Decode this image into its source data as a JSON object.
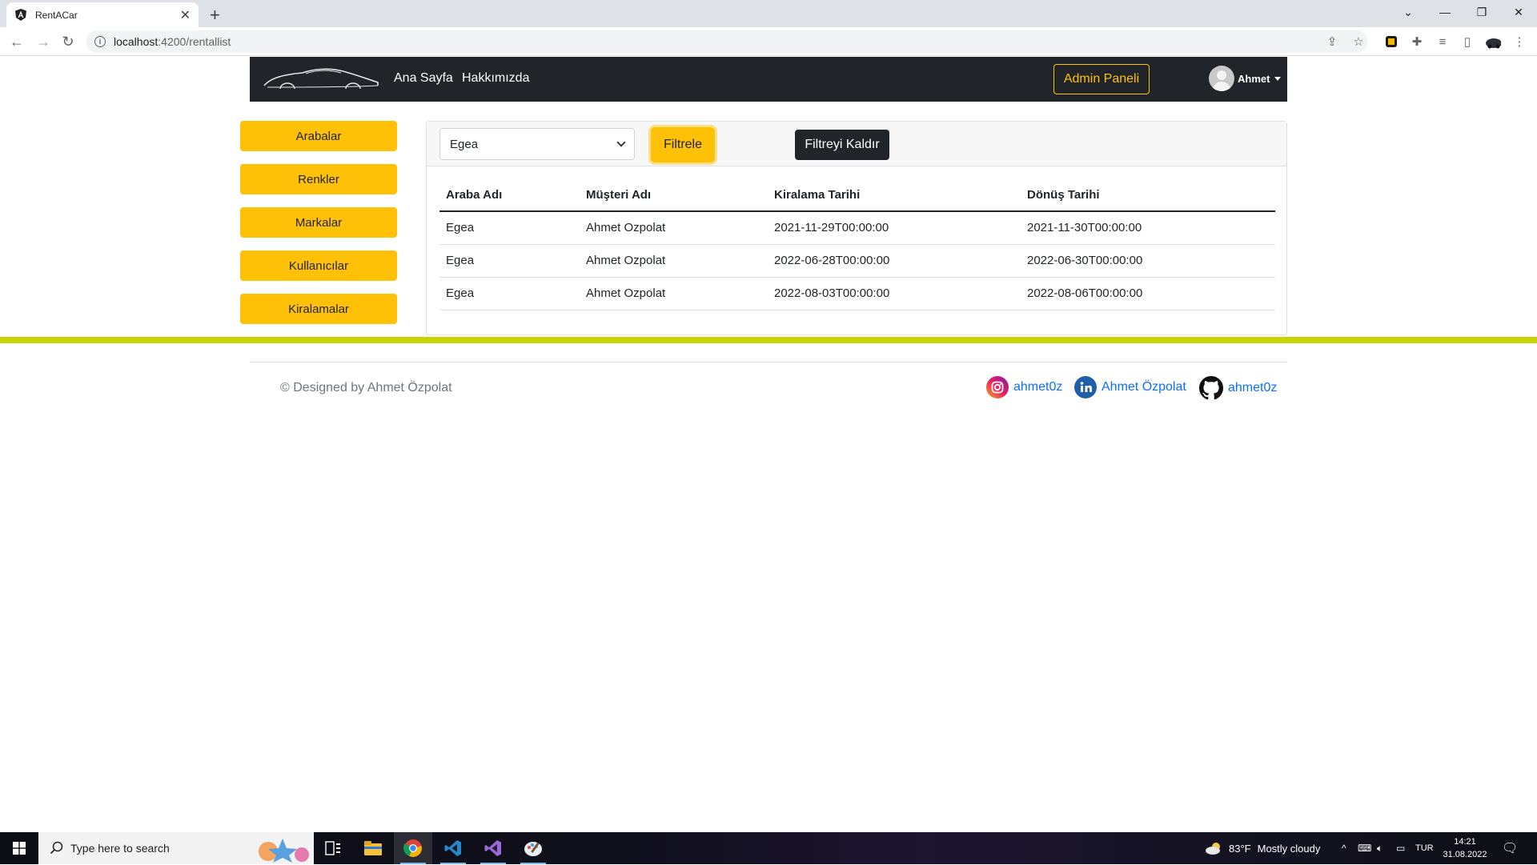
{
  "browser": {
    "tab_title": "RentACar",
    "url_host": "localhost",
    "url_path": ":4200/rentallist"
  },
  "navbar": {
    "links": [
      "Ana Sayfa",
      "Hakkımızda"
    ],
    "admin_label": "Admin Paneli",
    "user_name": "Ahmet"
  },
  "sidebar": {
    "items": [
      "Arabalar",
      "Renkler",
      "Markalar",
      "Kullanıcılar",
      "Kiralamalar"
    ]
  },
  "filter": {
    "selected_car": "Egea",
    "filter_label": "Filtrele",
    "clear_label": "Filtreyi Kaldır"
  },
  "table": {
    "columns": [
      "Araba Adı",
      "Müşteri Adı",
      "Kiralama Tarihi",
      "Dönüş Tarihi"
    ],
    "rows": [
      [
        "Egea",
        "Ahmet Ozpolat",
        "2021-11-29T00:00:00",
        "2021-11-30T00:00:00"
      ],
      [
        "Egea",
        "Ahmet Ozpolat",
        "2022-06-28T00:00:00",
        "2022-06-30T00:00:00"
      ],
      [
        "Egea",
        "Ahmet Ozpolat",
        "2022-08-03T00:00:00",
        "2022-08-06T00:00:00"
      ]
    ]
  },
  "footer": {
    "copyright": "© Designed by Ahmet Özpolat",
    "instagram": "ahmet0z",
    "linkedin": "Ahmet Özpolat",
    "github": "ahmet0z"
  },
  "taskbar": {
    "search_placeholder": "Type here to search",
    "weather_temp": "83°F",
    "weather_text": "Mostly cloudy",
    "language": "TUR",
    "time": "14:21",
    "date": "31.08.2022"
  },
  "colors": {
    "accent": "#ffc107",
    "navbar_bg": "#212529",
    "footer_line": "#c8d400",
    "link": "#0d6efd"
  }
}
